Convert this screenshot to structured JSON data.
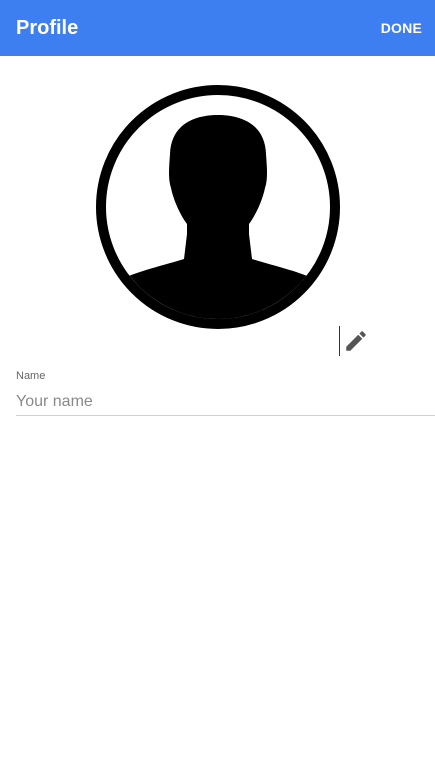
{
  "header": {
    "title": "Profile",
    "done_label": "DONE"
  },
  "avatar": {
    "icon": "person-placeholder-icon"
  },
  "edit": {
    "icon": "pencil-icon"
  },
  "name_field": {
    "label": "Name",
    "placeholder": "Your name",
    "value": ""
  },
  "colors": {
    "app_bar": "#3d7ff0",
    "app_bar_text": "#ffffff",
    "icon": "#555555"
  }
}
